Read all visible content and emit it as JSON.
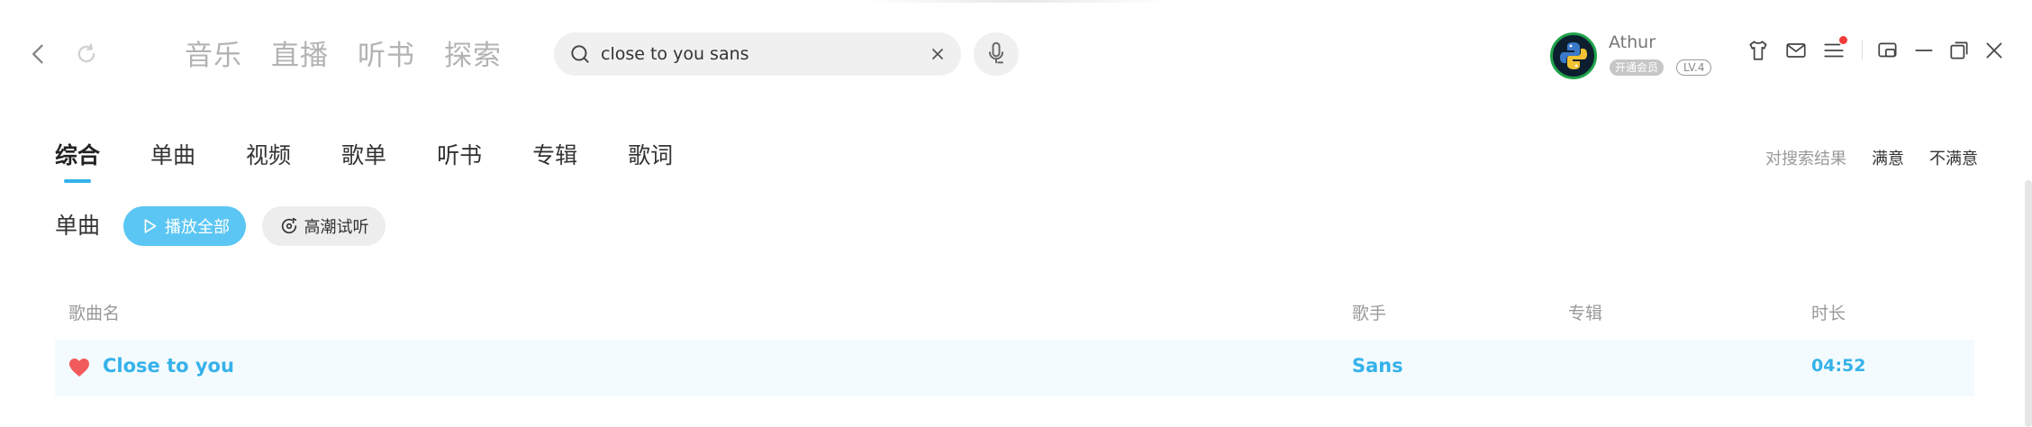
{
  "titlebar": {
    "main_tabs": [
      "音乐",
      "直播",
      "听书",
      "探索"
    ],
    "search": {
      "value": "close to you sans",
      "placeholder": ""
    },
    "user": {
      "name": "Athur",
      "vip_label": "开通会员",
      "level": "LV.4"
    },
    "icons": {
      "back": "chevron-left-icon",
      "refresh": "refresh-icon",
      "search": "search-icon",
      "clear": "close-icon",
      "voice": "microphone-icon",
      "skin": "tshirt-icon",
      "mail": "mail-icon",
      "menu": "menu-icon",
      "mini": "mini-player-icon",
      "minimize": "minimize-icon",
      "maximize": "maximize-icon",
      "close": "close-icon"
    },
    "notification": true
  },
  "content": {
    "sub_tabs": [
      "综合",
      "单曲",
      "视频",
      "歌单",
      "听书",
      "专辑",
      "歌词"
    ],
    "active_tab": "综合",
    "feedback": {
      "label": "对搜索结果",
      "satisfied": "满意",
      "unsatisfied": "不满意"
    },
    "section_title": "单曲",
    "play_all": "播放全部",
    "preview": "高潮试听",
    "table": {
      "headers": {
        "name": "歌曲名",
        "artist": "歌手",
        "album": "专辑",
        "duration": "时长"
      },
      "rows": [
        {
          "name": "Close to you",
          "artist": "Sans",
          "album": "",
          "duration": "04:52",
          "liked": true
        }
      ]
    }
  },
  "colors": {
    "accent": "#36b2ea",
    "play_button": "#5bc6f3",
    "row_highlight": "#f3fbfe",
    "heart": "#f25b5b",
    "notification_dot": "#f23a3a"
  }
}
